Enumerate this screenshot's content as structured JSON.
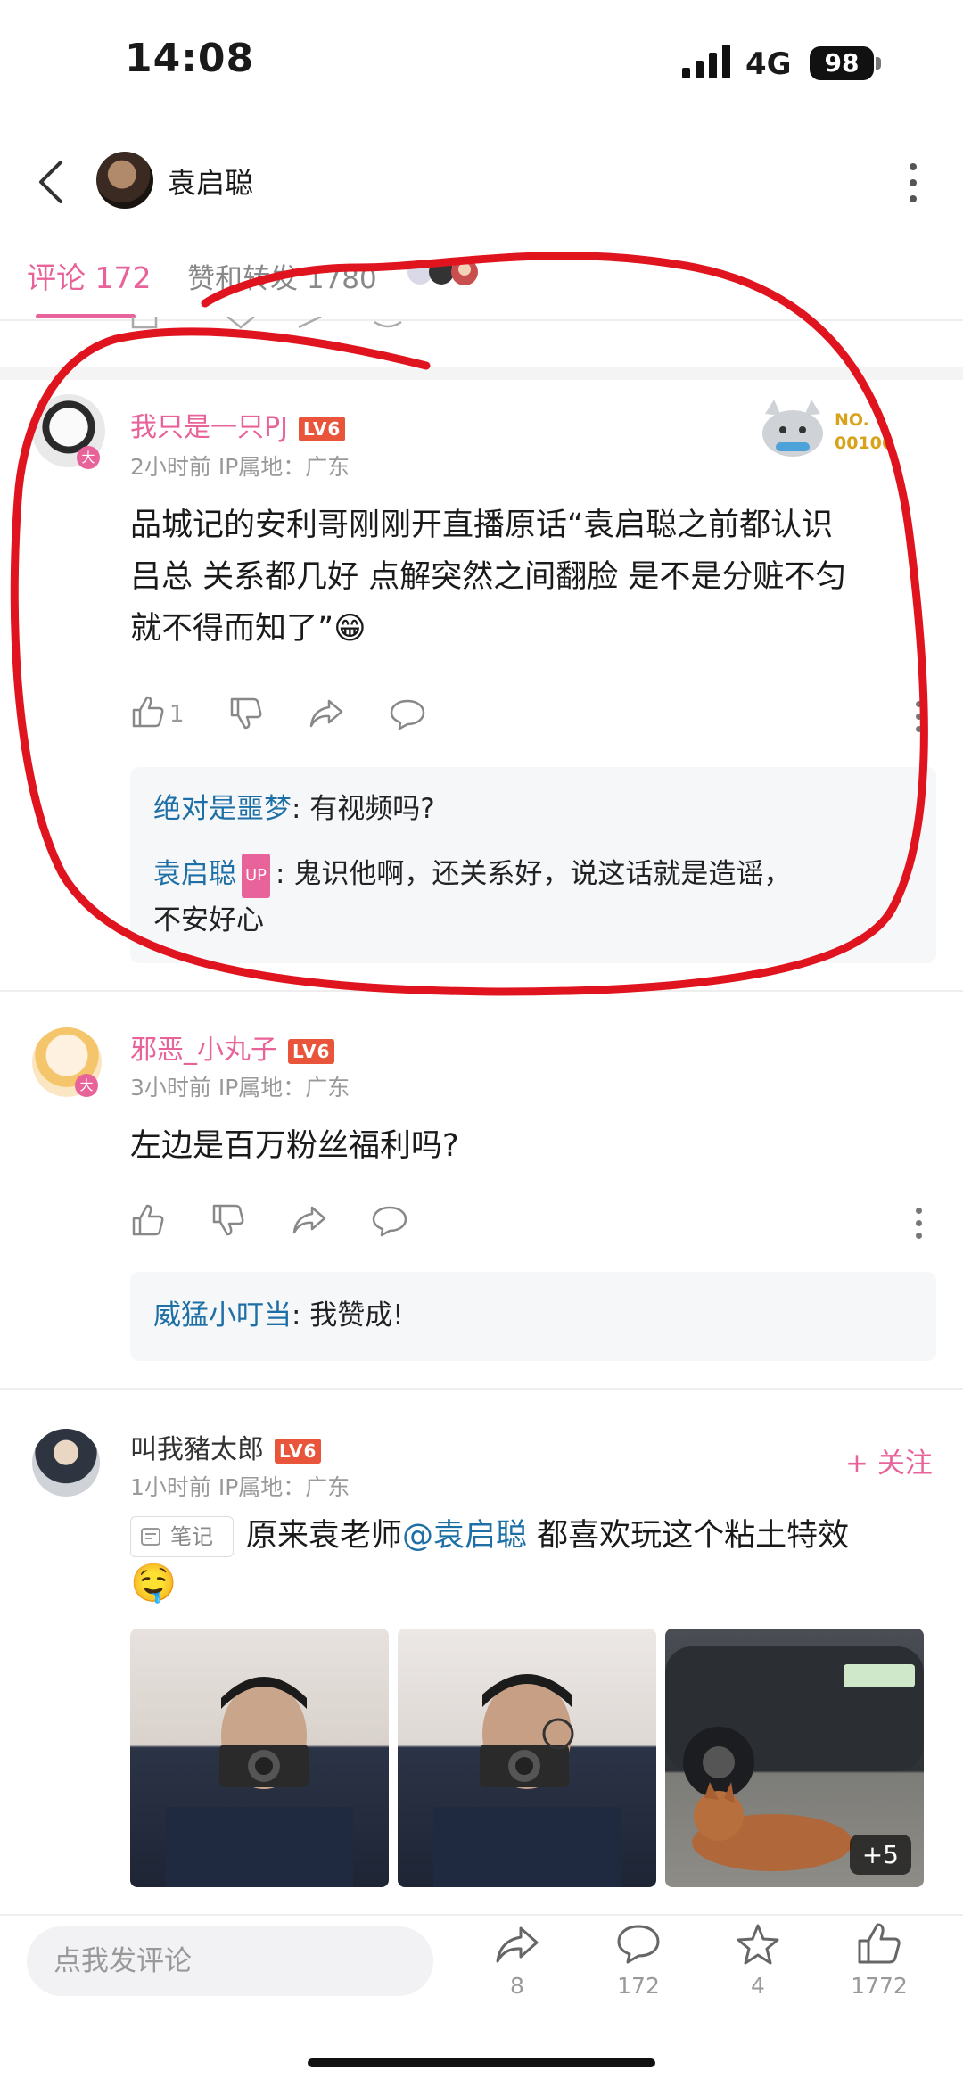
{
  "status_bar": {
    "time": "14:08",
    "network": "4G",
    "battery": "98"
  },
  "nav": {
    "title": "袁启聪"
  },
  "tabs": {
    "comments": "评论 172",
    "likes_reposts": "赞和转发 1780"
  },
  "comments": [
    {
      "user": "我只是一只PJ",
      "level": "LV6",
      "meta": "2小时前  IP属地：广东",
      "badge_text": "NO.\n00106",
      "text_lines": [
        "品城记的安利哥刚刚开直播原话“袁启聪之前都认识",
        "吕总 关系都几好 点解突然之间翻脸 是不是分赃不匀",
        "就不得而知了”😁"
      ],
      "likes": "1",
      "replies": [
        {
          "user": "绝对是噩梦",
          "text": ": 有视频吗?"
        },
        {
          "user": "袁启聪",
          "tag": "UP",
          "text_lines": [
            ": 鬼识他啊，还关系好，说这话就是造谣，",
            "不安好心"
          ]
        }
      ]
    },
    {
      "user": "邪恶_小丸子",
      "level": "LV6",
      "meta": "3小时前  IP属地：广东",
      "text": "左边是百万粉丝福利吗?",
      "replies": [
        {
          "user": "威猛小叮当",
          "text": ": 我赞成!"
        }
      ]
    },
    {
      "user": "叫我豬太郎",
      "level": "LV6",
      "meta": "1小时前  IP属地：广东",
      "follow_label": "+ 关注",
      "note_tag": "笔记",
      "text_before": "原来袁老师",
      "mention": "@袁启聪",
      "text_after": "都喜欢玩这个粘土特效",
      "emoji": "🤤",
      "more_images": "+5"
    }
  ],
  "bottom_bar": {
    "input_placeholder": "点我发评论",
    "share_count": "8",
    "comment_count": "172",
    "fav_count": "4",
    "like_count": "1772"
  },
  "colors": {
    "accent_pink": "#e8639a",
    "link_blue": "#1d6fa5",
    "level_red": "#e8553a",
    "annotation_red": "#e0141e"
  }
}
